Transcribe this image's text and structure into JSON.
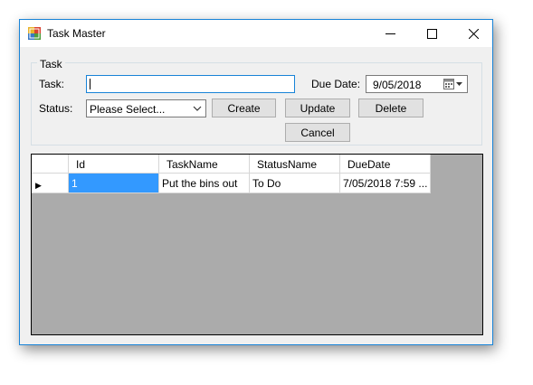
{
  "window": {
    "title": "Task Master",
    "controls": {
      "minimize": "—",
      "maximize": "☐",
      "close": "✕"
    }
  },
  "group": {
    "label": "Task"
  },
  "form": {
    "task_label": "Task:",
    "task_value": "",
    "due_label": "Due Date:",
    "due_value": "9/05/2018",
    "status_label": "Status:",
    "status_value": "Please Select..."
  },
  "buttons": {
    "create": "Create",
    "update": "Update",
    "delete": "Delete",
    "cancel": "Cancel"
  },
  "grid": {
    "columns": [
      "Id",
      "TaskName",
      "StatusName",
      "DueDate"
    ],
    "rows": [
      [
        "1",
        "Put the bins out",
        "To Do",
        "7/05/2018 7:59 ..."
      ]
    ],
    "current_row_marker": "▶"
  },
  "colors": {
    "accent": "#1883d7",
    "selection": "#3399ff",
    "grid_background": "#ababab"
  }
}
